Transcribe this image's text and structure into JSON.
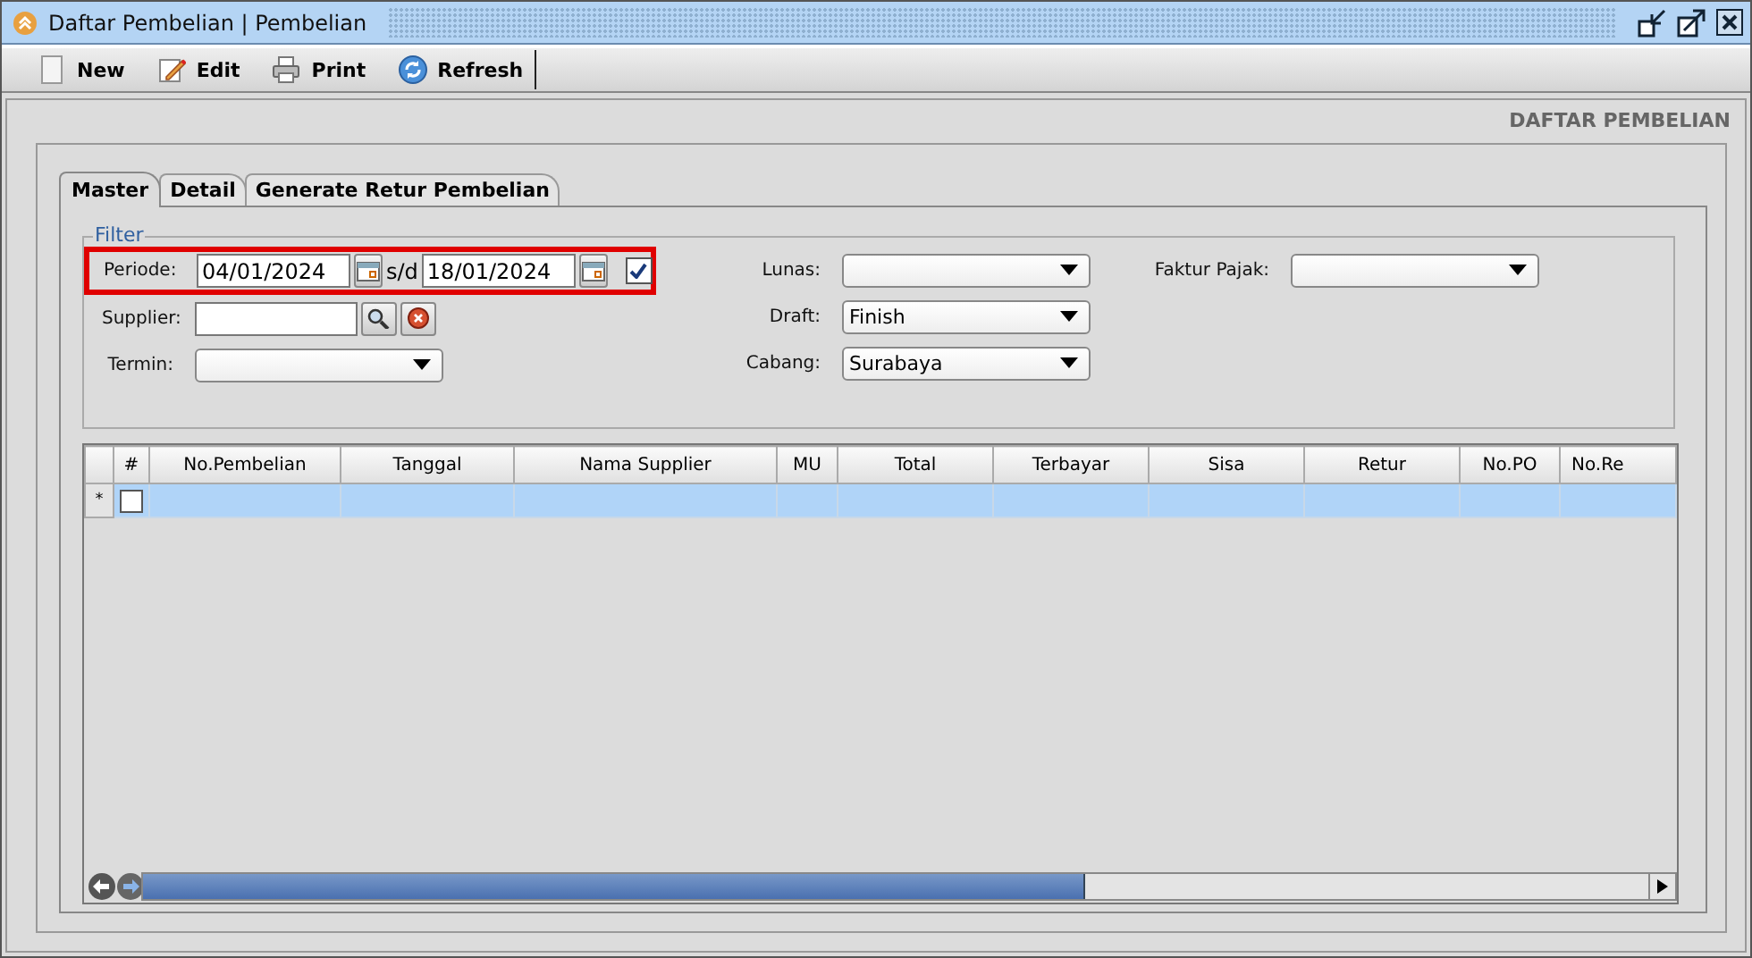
{
  "window": {
    "title": "Daftar Pembelian | Pembelian"
  },
  "toolbar": [
    {
      "kind": "new",
      "label": "New"
    },
    {
      "kind": "edit",
      "label": "Edit"
    },
    {
      "kind": "print",
      "label": "Print"
    },
    {
      "kind": "refresh",
      "label": "Refresh"
    }
  ],
  "header": "DAFTAR PEMBELIAN",
  "tabs": [
    {
      "label": "Master",
      "selected": true
    },
    {
      "label": "Detail",
      "selected": false
    },
    {
      "label": "Generate Retur Pembelian",
      "selected": false
    }
  ],
  "filter": {
    "title": "Filter",
    "periode": {
      "label": "Periode:",
      "from": "04/01/2024",
      "separator": "s/d",
      "to": "18/01/2024",
      "checked": true
    },
    "supplier": {
      "label": "Supplier:"
    },
    "termin": {
      "label": "Termin:"
    },
    "lunas": {
      "label": "Lunas:"
    },
    "draft": {
      "label": "Draft:",
      "value": "Finish"
    },
    "cabang": {
      "label": "Cabang:",
      "value": "Surabaya"
    },
    "faktur_pajak": {
      "label": "Faktur Pajak:"
    }
  },
  "table": {
    "columns": [
      "#",
      "No.Pembelian",
      "Tanggal",
      "Nama Supplier",
      "MU",
      "Total",
      "Terbayar",
      "Sisa",
      "Retur",
      "No.PO",
      "No.Re"
    ],
    "rows": [
      {
        "marker": "*",
        "checked": false,
        "selected": true
      }
    ]
  }
}
